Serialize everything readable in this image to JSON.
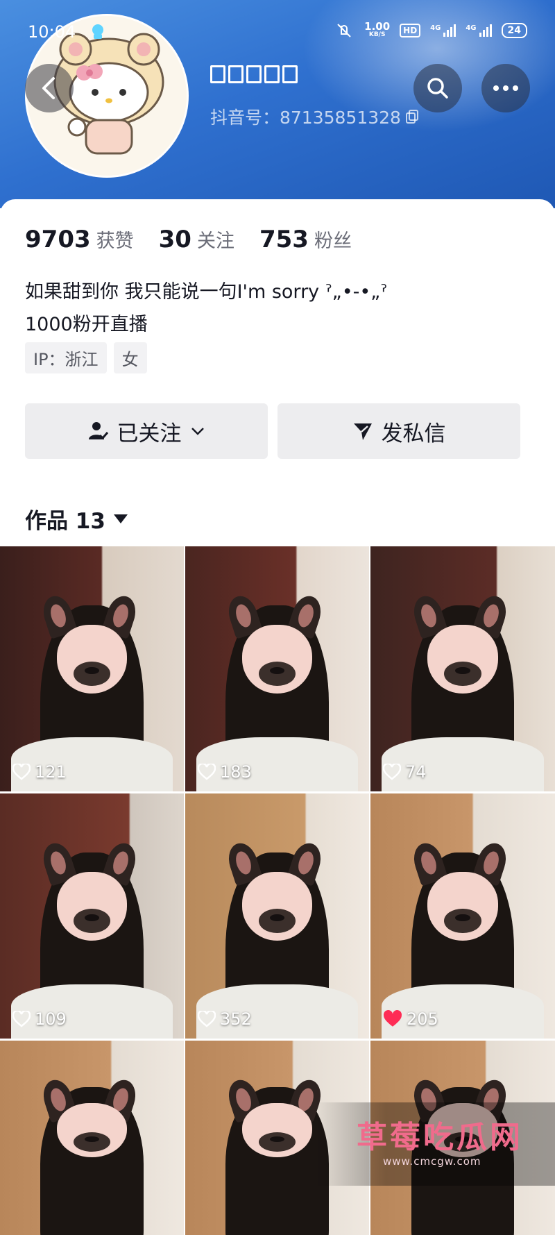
{
  "status_bar": {
    "time": "10:04",
    "net_speed": "1.00",
    "net_unit": "KB/S",
    "hd": "HD",
    "sim1": "4G",
    "sim2": "4G",
    "battery": "24"
  },
  "profile": {
    "nickname": "",
    "douyin_id": "抖音号：87135851328"
  },
  "stats": [
    {
      "value": "9703",
      "label": "获赞"
    },
    {
      "value": "30",
      "label": "关注"
    },
    {
      "value": "753",
      "label": "粉丝"
    }
  ],
  "bio": {
    "line1": "如果甜到你 我只能说一句I'm sorry ˀ„•-•„ˀ",
    "line2": "1000粉开直播"
  },
  "tags": {
    "ip": "IP：浙江",
    "gender": "女"
  },
  "actions": {
    "followed_label": "已关注",
    "message_label": "发私信"
  },
  "works": {
    "label": "作品 13"
  },
  "videos": [
    {
      "likes": "121",
      "liked": false
    },
    {
      "likes": "183",
      "liked": false
    },
    {
      "likes": "74",
      "liked": false
    },
    {
      "likes": "109",
      "liked": false
    },
    {
      "likes": "352",
      "liked": false
    },
    {
      "likes": "205",
      "liked": true
    }
  ],
  "watermark": {
    "title": "草莓吃瓜网",
    "url": "www.cmcgw.com"
  },
  "colors": {
    "header_blue": "#2f70cf",
    "liked_red": "#fe2c55",
    "watermark_pink": "#f06b8c"
  },
  "icons": [
    "back-icon",
    "search-icon",
    "more-icon",
    "copy-icon",
    "user-check-icon",
    "chevron-down-icon",
    "send-icon",
    "heart-icon"
  ]
}
